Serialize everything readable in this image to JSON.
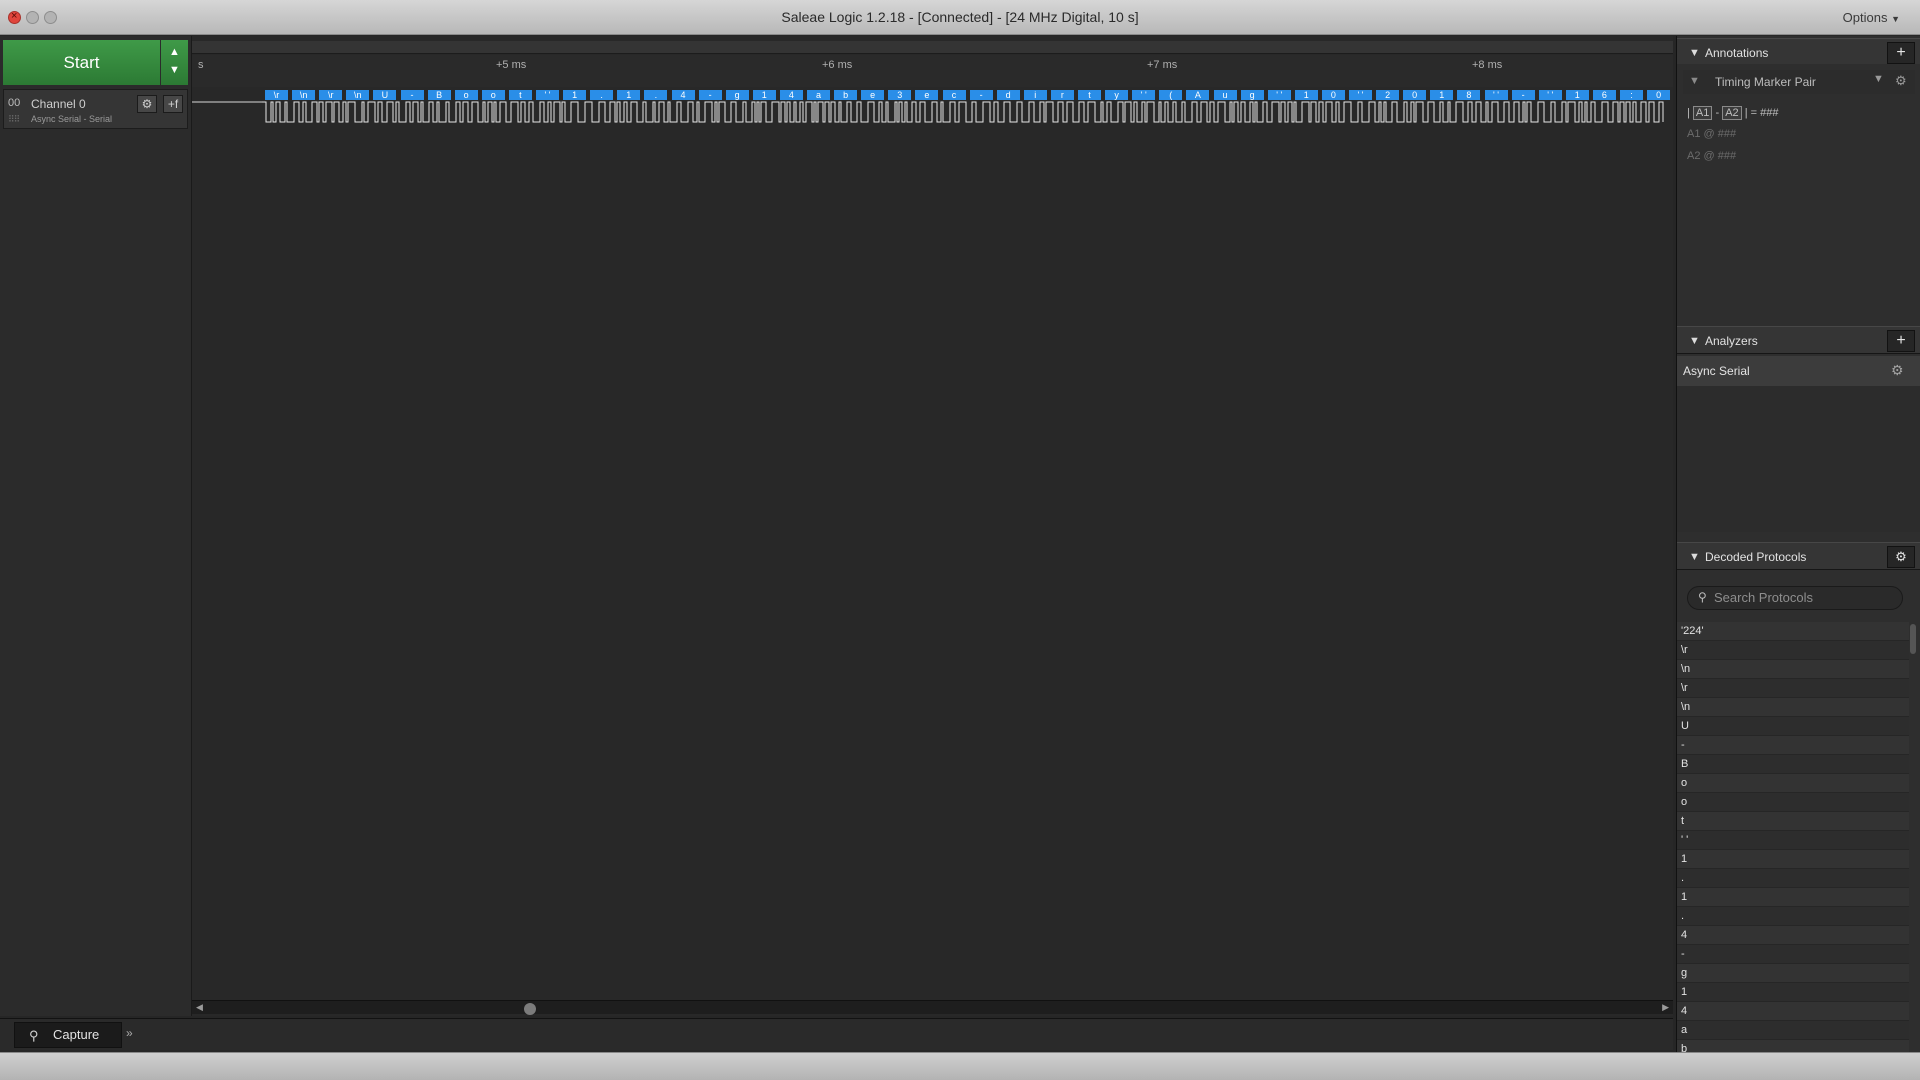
{
  "window": {
    "title": "Saleae Logic 1.2.18 - [Connected] - [24 MHz Digital, 10 s]",
    "options_label": "Options"
  },
  "toolbar": {
    "start_label": "Start",
    "start_arrows": "▲▼"
  },
  "channel": {
    "number": "00",
    "name": "Channel 0",
    "subtitle": "Async Serial - Serial",
    "add_label": "+f"
  },
  "timeline": {
    "start_fragment": "s",
    "ticks": [
      "+5 ms",
      "+6 ms",
      "+7 ms",
      "+8 ms"
    ]
  },
  "decoded_bubbles": [
    "\\r",
    "\\n",
    "\\r",
    "\\n",
    "U",
    "-",
    "B",
    "o",
    "o",
    "t",
    "' '",
    "1",
    ".",
    "1",
    ".",
    "4",
    "-",
    "g",
    "1",
    "4",
    "a",
    "b",
    "e",
    "3",
    "e",
    "c",
    "-",
    "d",
    "i",
    "r",
    "t",
    "y",
    "' '",
    "(",
    "A",
    "u",
    "g",
    "' '",
    "1",
    "0",
    "' '",
    "2",
    "0",
    "1",
    "8",
    "' '",
    "-",
    "' '",
    "1",
    "6",
    ":",
    "0"
  ],
  "annotations": {
    "title": "Annotations",
    "add_label": "+",
    "timing_marker_label": "Timing Marker Pair",
    "line1_prefix": "|",
    "line1_a1": "A1",
    "line1_sep": "-",
    "line1_a2": "A2",
    "line1_suffix": "| = ###",
    "line2": "A1  @  ###",
    "line3": "A2  @  ###"
  },
  "analyzers": {
    "title": "Analyzers",
    "add_label": "+",
    "item_label": "Async Serial"
  },
  "decoded_protocols": {
    "title": "Decoded Protocols",
    "search_placeholder": "Search Protocols",
    "rows": [
      "'224'",
      "\\r",
      "\\n",
      "\\r",
      "\\n",
      "U",
      "-",
      "B",
      "o",
      "o",
      "t",
      "' '",
      "1",
      ".",
      "1",
      ".",
      "4",
      "-",
      "g",
      "1",
      "4",
      "a",
      "b"
    ]
  },
  "capture": {
    "tab_label": "Capture",
    "more_label": "»"
  },
  "colors": {
    "start_green": "#3f9a48",
    "decode_blue": "#2a8ee8",
    "close_red": "#e0453c"
  }
}
